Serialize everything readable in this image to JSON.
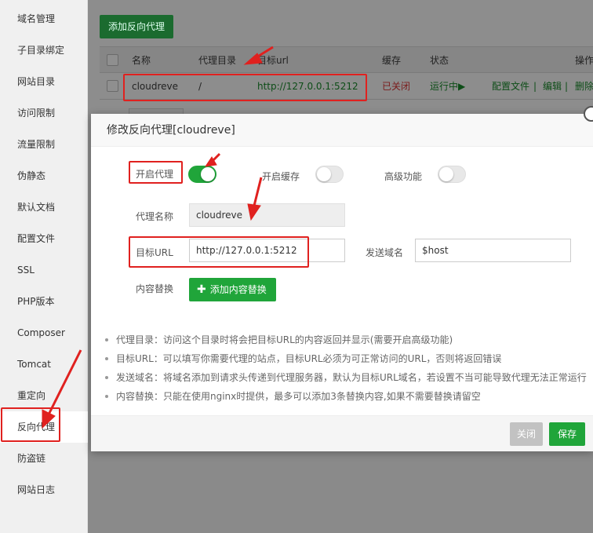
{
  "sidebar": {
    "items": [
      "域名管理",
      "子目录绑定",
      "网站目录",
      "访问限制",
      "流量限制",
      "伪静态",
      "默认文档",
      "配置文件",
      "SSL",
      "PHP版本",
      "Composer",
      "Tomcat",
      "重定向",
      "反向代理",
      "防盗链",
      "网站日志"
    ],
    "active_index": 13
  },
  "main": {
    "add_button": "添加反向代理",
    "table": {
      "headers": [
        "名称",
        "代理目录",
        "目标url",
        "缓存",
        "状态",
        "操作"
      ],
      "row": {
        "name": "cloudreve",
        "dir": "/",
        "url": "http://127.0.0.1:5212",
        "cache": "已关闭",
        "status": "运行中▶",
        "op_config": "配置文件",
        "op_sep": "|",
        "op_edit": "编辑",
        "op_delete": "删除"
      }
    }
  },
  "modal": {
    "title": "修改反向代理[cloudreve]",
    "enable_proxy_label": "开启代理",
    "enable_proxy": true,
    "enable_cache_label": "开启缓存",
    "enable_cache": false,
    "advanced_label": "高级功能",
    "advanced": false,
    "proxy_name_label": "代理名称",
    "proxy_name_value": "cloudreve",
    "target_url_label": "目标URL",
    "target_url_value": "http://127.0.0.1:5212",
    "send_domain_label": "发送域名",
    "send_domain_value": "$host",
    "content_replace_label": "内容替换",
    "add_replace_button": "添加内容替换",
    "tips": [
      "代理目录：访问这个目录时将会把目标URL的内容返回并显示(需要开启高级功能)",
      "目标URL：可以填写你需要代理的站点，目标URL必须为可正常访问的URL，否则将返回错误",
      "发送域名：将域名添加到请求头传递到代理服务器，默认为目标URL域名，若设置不当可能导致代理无法正常运行",
      "内容替换：只能在使用nginx时提供，最多可以添加3条替换内容,如果不需要替换请留空"
    ],
    "close_button": "关闭",
    "save_button": "保存"
  },
  "colors": {
    "accent_green": "#20a53a",
    "annotation_red": "#e0211f"
  }
}
